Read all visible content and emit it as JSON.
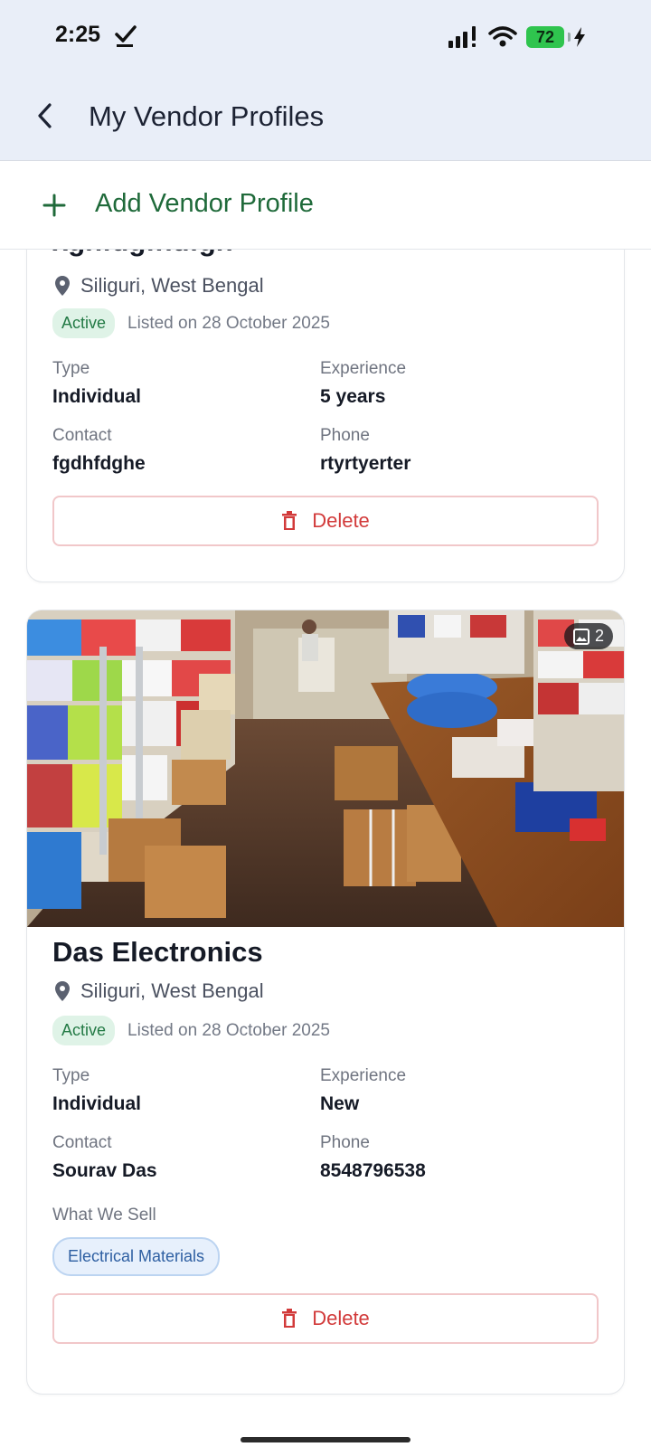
{
  "status": {
    "time": "2:25",
    "battery": "72"
  },
  "header": {
    "title": "My Vendor Profiles"
  },
  "add_profile": {
    "label": "Add Vendor Profile"
  },
  "profiles": [
    {
      "name": "xgnfdgfndfgh",
      "location": "Siliguri, West Bengal",
      "status": "Active",
      "listed": "Listed on 28 October 2025",
      "type_label": "Type",
      "type": "Individual",
      "experience_label": "Experience",
      "experience": "5 years",
      "contact_label": "Contact",
      "contact": "fgdhfdghe",
      "phone_label": "Phone",
      "phone": "rtyrtyerter",
      "delete_label": "Delete"
    },
    {
      "name": "Das Electronics",
      "image_count": "2",
      "location": "Siliguri, West Bengal",
      "status": "Active",
      "listed": "Listed on 28 October 2025",
      "type_label": "Type",
      "type": "Individual",
      "experience_label": "Experience",
      "experience": "New",
      "contact_label": "Contact",
      "contact": "Sourav Das",
      "phone_label": "Phone",
      "phone": "8548796538",
      "sell_label": "What We Sell",
      "sells": [
        "Electrical Materials"
      ],
      "delete_label": "Delete"
    }
  ],
  "colors": {
    "accent_green": "#1f6a3a",
    "danger": "#d23a3a",
    "header_bg": "#e9eef8"
  }
}
